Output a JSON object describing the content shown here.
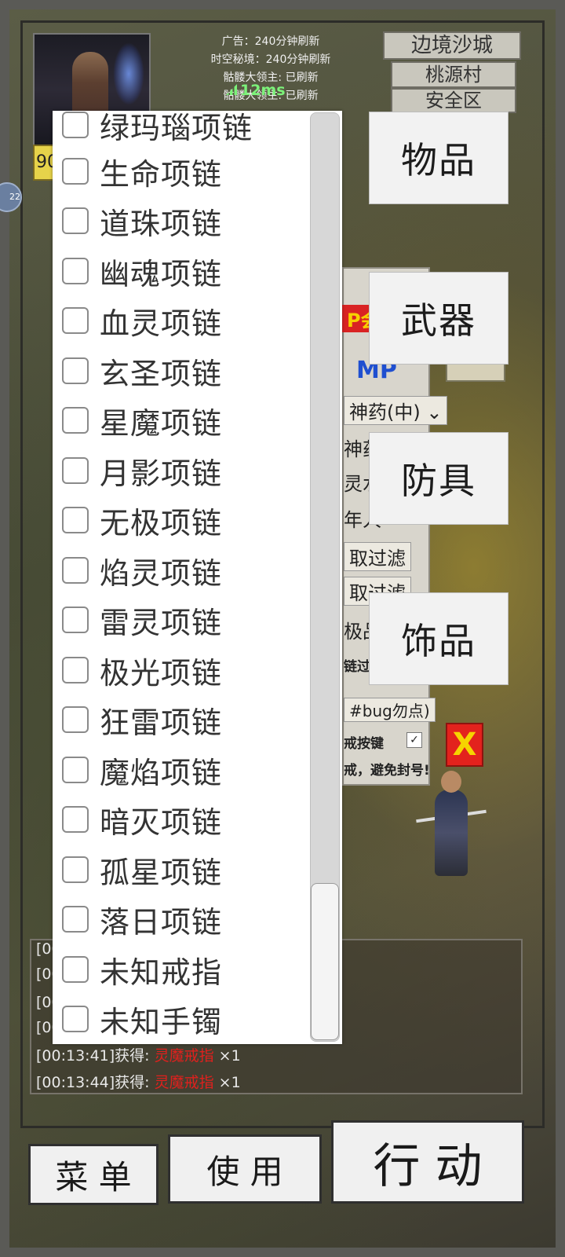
{
  "hud": {
    "level_text": "90",
    "announcements": [
      "广告：240分钟刷新",
      "时空秘境：240分钟刷新",
      "骷髅大领主: 已刷新",
      "骷髅大领主: 已刷新"
    ],
    "ping": "12ms",
    "locations": [
      "边境沙城",
      "桃源村",
      "安全区"
    ],
    "side_badge": "22"
  },
  "background_panel": {
    "hp_label": "P会",
    "mp_label": "MP",
    "potion_select": "神药(中)",
    "rows": [
      "神药",
      "灵水",
      "年人",
      "取过滤",
      "取过滤",
      "极品",
      "链过",
      "#bug勿点)",
      "戒按键",
      "戒，避免封号!"
    ]
  },
  "close_button": {
    "label": "X"
  },
  "category_buttons": [
    "物品",
    "武器",
    "防具",
    "饰品"
  ],
  "filter_list": {
    "items": [
      {
        "label": "绿玛瑙项链",
        "checked": false
      },
      {
        "label": "生命项链",
        "checked": false
      },
      {
        "label": "道珠项链",
        "checked": false
      },
      {
        "label": "幽魂项链",
        "checked": false
      },
      {
        "label": "血灵项链",
        "checked": false
      },
      {
        "label": "玄圣项链",
        "checked": false
      },
      {
        "label": "星魔项链",
        "checked": false
      },
      {
        "label": "月影项链",
        "checked": false
      },
      {
        "label": "无极项链",
        "checked": false
      },
      {
        "label": "焰灵项链",
        "checked": false
      },
      {
        "label": "雷灵项链",
        "checked": false
      },
      {
        "label": "极光项链",
        "checked": false
      },
      {
        "label": "狂雷项链",
        "checked": false
      },
      {
        "label": "魔焰项链",
        "checked": false
      },
      {
        "label": "暗灭项链",
        "checked": false
      },
      {
        "label": "孤星项链",
        "checked": false
      },
      {
        "label": "落日项链",
        "checked": false
      },
      {
        "label": "未知戒指",
        "checked": false
      },
      {
        "label": "未知手镯",
        "checked": false
      }
    ]
  },
  "log": {
    "stubs": [
      "[00",
      "[00",
      "[00",
      "[00"
    ],
    "lines": [
      {
        "time": "[00:13:41]获得: ",
        "item": "灵魔戒指",
        "count": " ×1"
      },
      {
        "time": "[00:13:44]获得: ",
        "item": "灵魔戒指",
        "count": " ×1"
      }
    ]
  },
  "bottom_buttons": {
    "menu": "菜 单",
    "use": "使 用",
    "action": "行 动"
  },
  "colors": {
    "item_red": "#e0201d",
    "ping_green": "#7cf27a",
    "mp_blue": "#1f4fd0"
  }
}
